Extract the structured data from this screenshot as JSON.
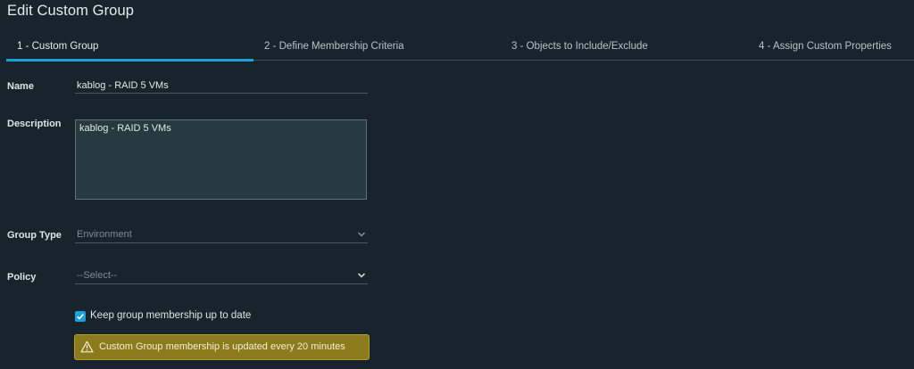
{
  "dialog": {
    "title": "Edit Custom Group"
  },
  "tabs": [
    {
      "label": "1 - Custom Group",
      "active": true
    },
    {
      "label": "2 - Define Membership Criteria",
      "active": false
    },
    {
      "label": "3 - Objects to Include/Exclude",
      "active": false
    },
    {
      "label": "4 - Assign Custom Properties",
      "active": false
    }
  ],
  "form": {
    "name": {
      "label": "Name",
      "value": "kablog - RAID 5 VMs"
    },
    "description": {
      "label": "Description",
      "value": "kablog - RAID 5 VMs"
    },
    "group_type": {
      "label": "Group Type",
      "value": "Environment"
    },
    "policy": {
      "label": "Policy",
      "value": "--Select--"
    },
    "keep_membership": {
      "label": "Keep group membership up to date",
      "checked": true
    }
  },
  "alert": {
    "text": "Custom Group membership is updated every 20 minutes",
    "icon": "warning-icon"
  },
  "colors": {
    "background": "#17242c",
    "accent": "#1aa1d9",
    "warning": "#8c7b1c"
  }
}
